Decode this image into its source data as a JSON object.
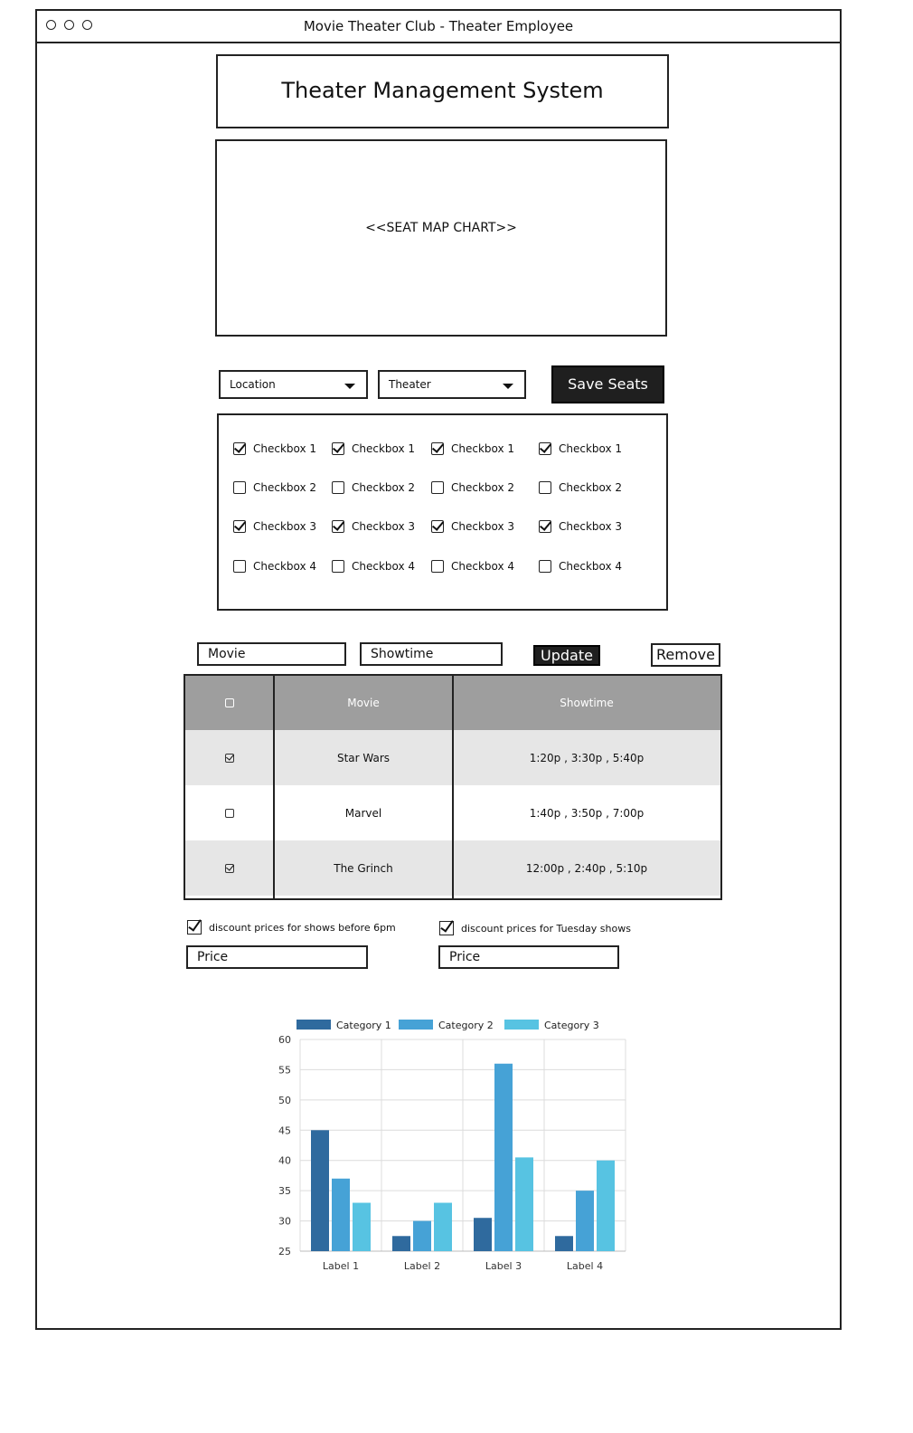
{
  "window": {
    "title": "Movie Theater Club - Theater Employee"
  },
  "header": {
    "title": "Theater Management System"
  },
  "seat_map": {
    "label": "<<SEAT MAP CHART>>"
  },
  "controls": {
    "location_label": "Location",
    "theater_label": "Theater",
    "save_label": "Save Seats"
  },
  "checkbox_grid": {
    "columns": [
      [
        {
          "label": "Checkbox 1",
          "checked": true
        },
        {
          "label": "Checkbox 2",
          "checked": false
        },
        {
          "label": "Checkbox 3",
          "checked": true
        },
        {
          "label": "Checkbox 4",
          "checked": false
        }
      ],
      [
        {
          "label": "Checkbox 1",
          "checked": true
        },
        {
          "label": "Checkbox 2",
          "checked": false
        },
        {
          "label": "Checkbox 3",
          "checked": true
        },
        {
          "label": "Checkbox 4",
          "checked": false
        }
      ],
      [
        {
          "label": "Checkbox 1",
          "checked": true
        },
        {
          "label": "Checkbox 2",
          "checked": false
        },
        {
          "label": "Checkbox 3",
          "checked": true
        },
        {
          "label": "Checkbox 4",
          "checked": false
        }
      ],
      [
        {
          "label": "Checkbox 1",
          "checked": true
        },
        {
          "label": "Checkbox 2",
          "checked": false
        },
        {
          "label": "Checkbox 3",
          "checked": true
        },
        {
          "label": "Checkbox 4",
          "checked": false
        }
      ]
    ]
  },
  "showtime_form": {
    "movie_placeholder": "Movie",
    "showtime_placeholder": "Showtime",
    "update_label": "Update",
    "remove_label": "Remove"
  },
  "table": {
    "headers": [
      "Movie",
      "Showtime"
    ],
    "rows": [
      {
        "checked": true,
        "movie": "Star Wars",
        "showtime": "1:20p , 3:30p , 5:40p"
      },
      {
        "checked": false,
        "movie": "Marvel",
        "showtime": "1:40p , 3:50p , 7:00p"
      },
      {
        "checked": true,
        "movie": "The Grinch",
        "showtime": "12:00p , 2:40p , 5:10p"
      }
    ]
  },
  "discounts": {
    "before6": {
      "label": "discount prices for shows before 6pm",
      "checked": true,
      "price_placeholder": "Price"
    },
    "tuesday": {
      "label": "discount prices for Tuesday shows",
      "checked": true,
      "price_placeholder": "Price"
    }
  },
  "colors": {
    "cat1": "#2f6a9e",
    "cat2": "#46a2d6",
    "cat3": "#57c3e2",
    "table_header": "#9e9e9e",
    "table_stripe": "#e6e6e6",
    "dark_button": "#1f1f1f"
  },
  "chart_data": {
    "type": "bar",
    "categories": [
      "Label 1",
      "Label 2",
      "Label 3",
      "Label 4"
    ],
    "series": [
      {
        "name": "Category 1",
        "values": [
          45,
          27.5,
          30.5,
          27.5
        ]
      },
      {
        "name": "Category 2",
        "values": [
          37,
          30,
          56,
          35
        ]
      },
      {
        "name": "Category 3",
        "values": [
          33,
          33,
          40.5,
          40
        ]
      }
    ],
    "ylim": [
      25,
      60
    ],
    "yticks": [
      25,
      30,
      35,
      40,
      45,
      50,
      55,
      60
    ],
    "grid": true,
    "legend": "top"
  }
}
